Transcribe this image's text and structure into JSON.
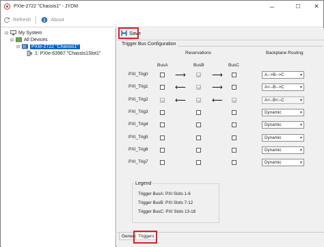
{
  "window": {
    "title": "PXIe-2722 \"Chassis1\" - JYDM",
    "minimize": "─",
    "maximize": "☐",
    "close": "✕"
  },
  "toolbar": {
    "refresh_label": "Refresh",
    "about_label": "About"
  },
  "tree": {
    "items": [
      {
        "label": "My System"
      },
      {
        "label": "All Devices"
      },
      {
        "label": "PXIe-2722 \"Chassis1\""
      },
      {
        "label": "1: PXIe-63987 \"Chassis1Slot1\""
      }
    ]
  },
  "panel": {
    "save_label": "Save",
    "group_title": "Trigger Bus Configuration",
    "reservations_header": "Reservations",
    "backplane_header": "Backplane Routing",
    "bus_headers": [
      "BusA",
      "BusB",
      "BusC"
    ],
    "rows": [
      {
        "label": "PXI_Trig0",
        "busA": false,
        "busB": true,
        "busC": false,
        "arrow1": "⟶",
        "arrow2": "⟶",
        "routing": "A-->B-->C",
        "routing_enabled": true
      },
      {
        "label": "PXI_Trig1",
        "busA": false,
        "busB": true,
        "busC": false,
        "arrow1": "⟵",
        "arrow2": "⟶",
        "routing": "A<--B-->C",
        "routing_enabled": true
      },
      {
        "label": "PXI_Trig2",
        "busA": true,
        "busB": true,
        "busC": true,
        "arrow1": "⟵",
        "arrow2": "⟵",
        "routing": "A<--B<--C",
        "routing_enabled": false
      },
      {
        "label": "PXI_Trig3",
        "busA": false,
        "busB": false,
        "busC": false,
        "arrow1": "",
        "arrow2": "",
        "routing": "Dynamic",
        "routing_enabled": true
      },
      {
        "label": "PXI_Trig4",
        "busA": false,
        "busB": false,
        "busC": false,
        "arrow1": "",
        "arrow2": "",
        "routing": "Dynamic",
        "routing_enabled": true
      },
      {
        "label": "PXI_Trig5",
        "busA": false,
        "busB": false,
        "busC": false,
        "arrow1": "",
        "arrow2": "",
        "routing": "Dynamic",
        "routing_enabled": true
      },
      {
        "label": "PXI_Trig6",
        "busA": false,
        "busB": false,
        "busC": false,
        "arrow1": "",
        "arrow2": "",
        "routing": "Dynamic",
        "routing_enabled": true
      },
      {
        "label": "PXI_Trig7",
        "busA": false,
        "busB": false,
        "busC": false,
        "arrow1": "",
        "arrow2": "",
        "routing": "Dynamic",
        "routing_enabled": true
      }
    ],
    "legend": {
      "title": "Legend",
      "items": [
        "Trigger BusA: PXI Slots 1-6",
        "Trigger BusB: PXI Slots 7-12",
        "Trigger BusC: PXI Slots 13-18"
      ]
    }
  },
  "tabs": [
    {
      "label": "General"
    },
    {
      "label": "Triggers"
    }
  ],
  "colors": {
    "highlight_red": "#e01c24",
    "selection_blue": "#0a64c8",
    "panel_bg": "#f0f0f0"
  }
}
